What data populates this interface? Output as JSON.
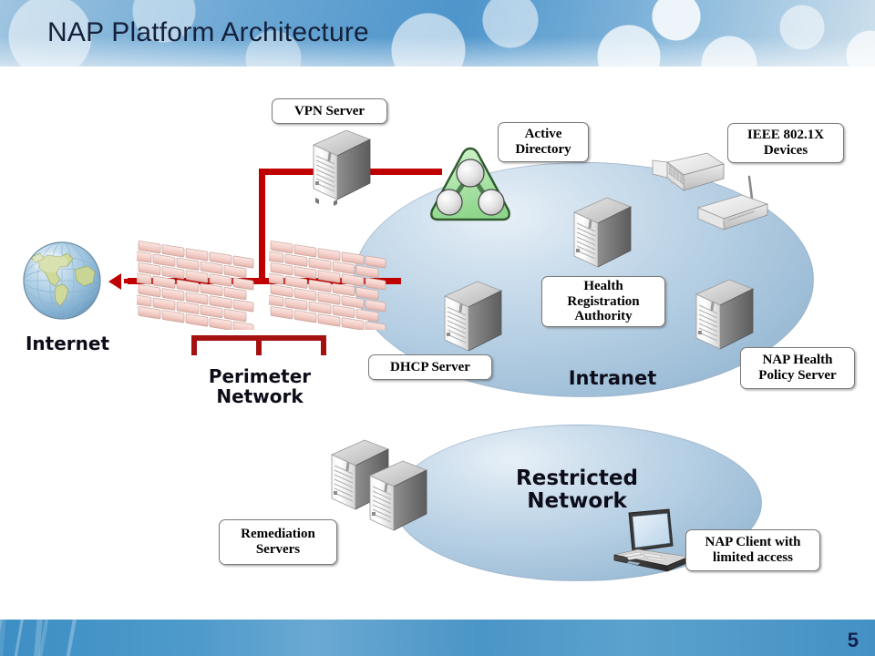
{
  "slide": {
    "title": "NAP Platform Architecture",
    "page_number": "5",
    "header_color": "#4e95cb",
    "footer_color": "#4490c5",
    "wire_color": "#c00000",
    "intranet_fill": "#b3cde2",
    "ad_fill": "#b9e8b9"
  },
  "labels": {
    "vpn_server": "VPN Server",
    "active_directory": "Active\nDirectory",
    "ieee_devices": "IEEE 802.1X\nDevices",
    "health_registration_authority": "Health\nRegistration\nAuthority",
    "dhcp_server": "DHCP Server",
    "nap_health_policy_server": "NAP Health\nPolicy Server",
    "remediation_servers": "Remediation\nServers",
    "nap_client": "NAP Client with\nlimited access"
  },
  "regions": {
    "internet": "Internet",
    "perimeter_network": "Perimeter\nNetwork",
    "intranet": "Intranet",
    "restricted_network": "Restricted\nNetwork"
  },
  "icons": {
    "globe": "globe-icon",
    "firewall_left": "firewall-brick-wall-icon",
    "firewall_right": "firewall-brick-wall-icon",
    "vpn_server": "server-tower-icon",
    "active_directory": "active-directory-triangle-icon",
    "network_switch": "network-switch-icon",
    "wireless_access_point": "wireless-access-point-icon",
    "health_registration_authority_server": "server-tower-icon",
    "dhcp_server": "server-tower-icon",
    "nap_health_policy_server": "server-tower-icon",
    "remediation_server_1": "server-tower-icon",
    "remediation_server_2": "server-tower-icon",
    "nap_client_laptop": "laptop-icon"
  }
}
